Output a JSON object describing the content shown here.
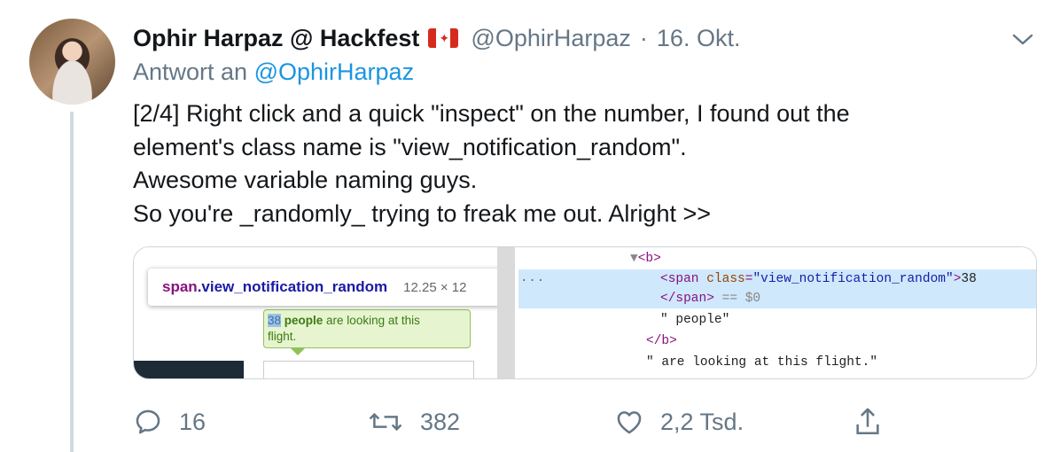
{
  "tweet": {
    "author_name": "Ophir Harpaz @ Hackfest",
    "flag": "canada-flag-icon",
    "handle": "@OphirHarpaz",
    "separator": "·",
    "date": "16. Okt.",
    "reply_prefix": "Antwort an",
    "reply_handle": "@OphirHarpaz",
    "text_lines": [
      "[2/4] Right click and a quick \"inspect\" on the number, I found out the",
      "element's class name is \"view_notification_random\".",
      "Awesome variable naming guys.",
      "So you're _randomly_ trying to freak me out. Alright >>"
    ]
  },
  "media": {
    "tooltip": {
      "element": "span",
      "class": ".view_notification_random",
      "dimensions": "12.25 × 12"
    },
    "bubble": {
      "number": "38",
      "bold_text": " people",
      "rest_line1": " are looking at this",
      "line2": "flight."
    },
    "devtools": {
      "ellipsis": "···",
      "lines": [
        {
          "indent": "      ",
          "arrow": "▼",
          "tag_open": "<b>"
        },
        {
          "indent": "          ",
          "tag": "<span ",
          "attr": "class",
          "eq": "=",
          "val": "\"view_notification_random\"",
          "close": ">",
          "text": "38"
        },
        {
          "indent": "          ",
          "tag": "</span>",
          "suffix": " == $0"
        },
        {
          "indent": "          ",
          "text": "\" people\""
        },
        {
          "indent": "        ",
          "tag": "</b>"
        },
        {
          "indent": "       ",
          "text": "\" are looking at this flight.\""
        }
      ]
    }
  },
  "actions": {
    "replies": "16",
    "retweets": "382",
    "likes": "2,2 Tsd.",
    "share": ""
  },
  "colors": {
    "link": "#1b95e0",
    "muted": "#657786",
    "text": "#14171a"
  }
}
